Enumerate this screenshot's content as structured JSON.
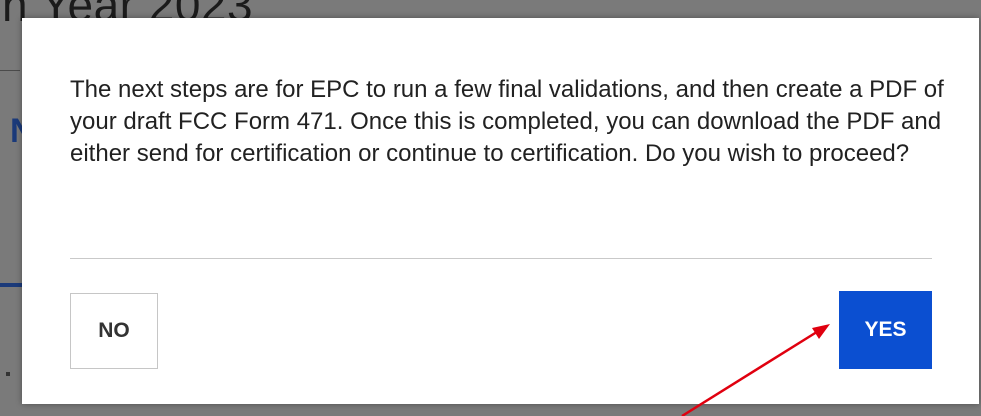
{
  "background": {
    "heading_fragment": "n Year 2023",
    "side_letter": "N"
  },
  "modal": {
    "message": "The next steps are for EPC to run a few final validations, and then create a PDF of your draft FCC Form 471. Once this is completed, you can download the PDF and either send for certification or continue to certification. Do you wish to proceed?",
    "no_label": "NO",
    "yes_label": "YES"
  },
  "colors": {
    "overlay": "#6f6f6f",
    "modal_background": "#ffffff",
    "primary_button": "#0b4fd1",
    "annotation_arrow": "#e0000f"
  },
  "annotation": {
    "type": "arrow",
    "icon": "red-arrow-icon",
    "points_to": "yes-button"
  }
}
